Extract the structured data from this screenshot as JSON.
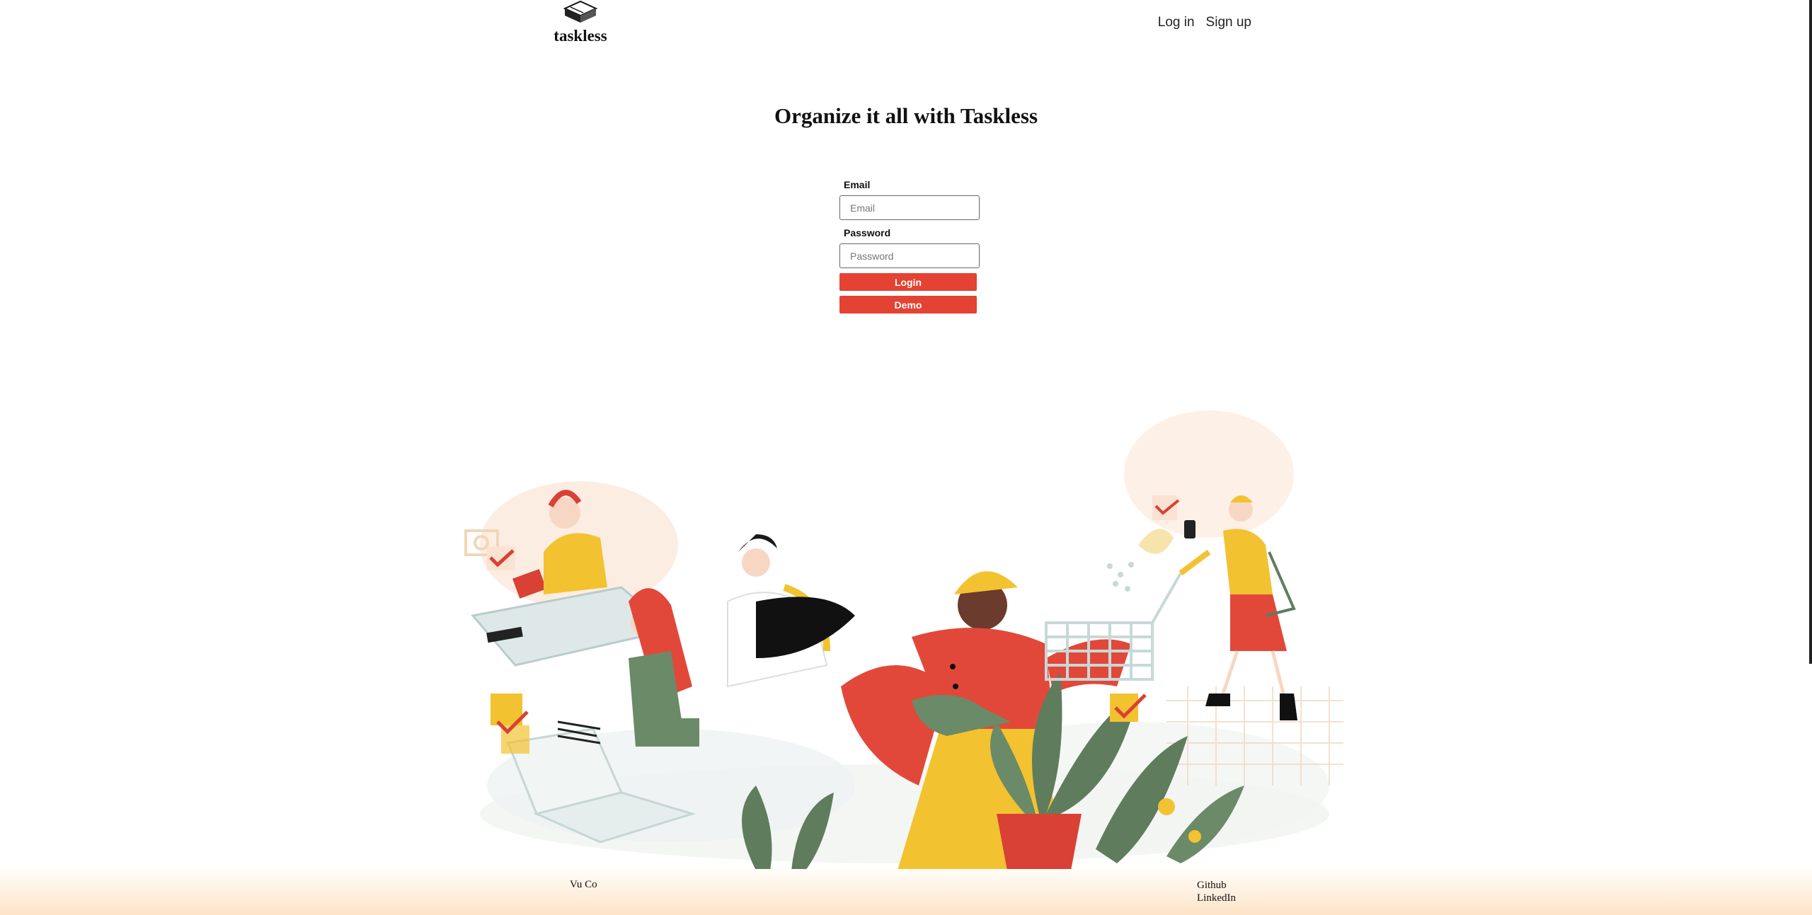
{
  "header": {
    "logo_icon": "box-logo-icon",
    "logo_text": "taskless",
    "nav": {
      "login": "Log in",
      "signup": "Sign up"
    }
  },
  "main": {
    "title": "Organize it all with Taskless",
    "form": {
      "email_label": "Email",
      "email_placeholder": "Email",
      "password_label": "Password",
      "password_placeholder": "Password",
      "login_button": "Login",
      "demo_button": "Demo"
    },
    "hero_icon": "people-tasks-illustration"
  },
  "footer": {
    "author": "Vu Co",
    "links": [
      "Github",
      "LinkedIn"
    ]
  },
  "colors": {
    "accent": "#e44232",
    "illustration_yellow": "#f2c230",
    "illustration_green": "#5f7d5d",
    "footer_gradient_end": "#fde4c8"
  }
}
